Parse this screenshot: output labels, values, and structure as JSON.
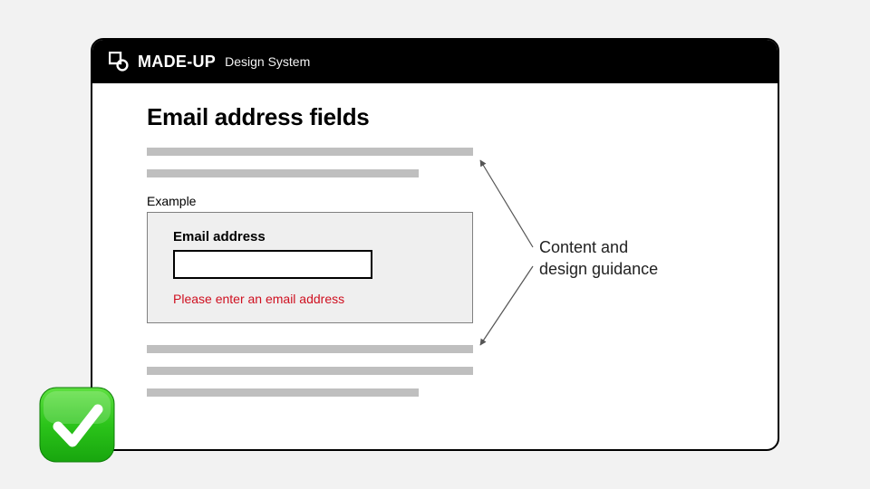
{
  "brand": {
    "name": "MADE-UP",
    "sub": "Design System"
  },
  "page": {
    "title": "Email address fields",
    "example_label": "Example",
    "field_label": "Email address",
    "field_value": "",
    "error_message": "Please enter an email address"
  },
  "annotation": {
    "line1": "Content and",
    "line2": "design guidance"
  }
}
